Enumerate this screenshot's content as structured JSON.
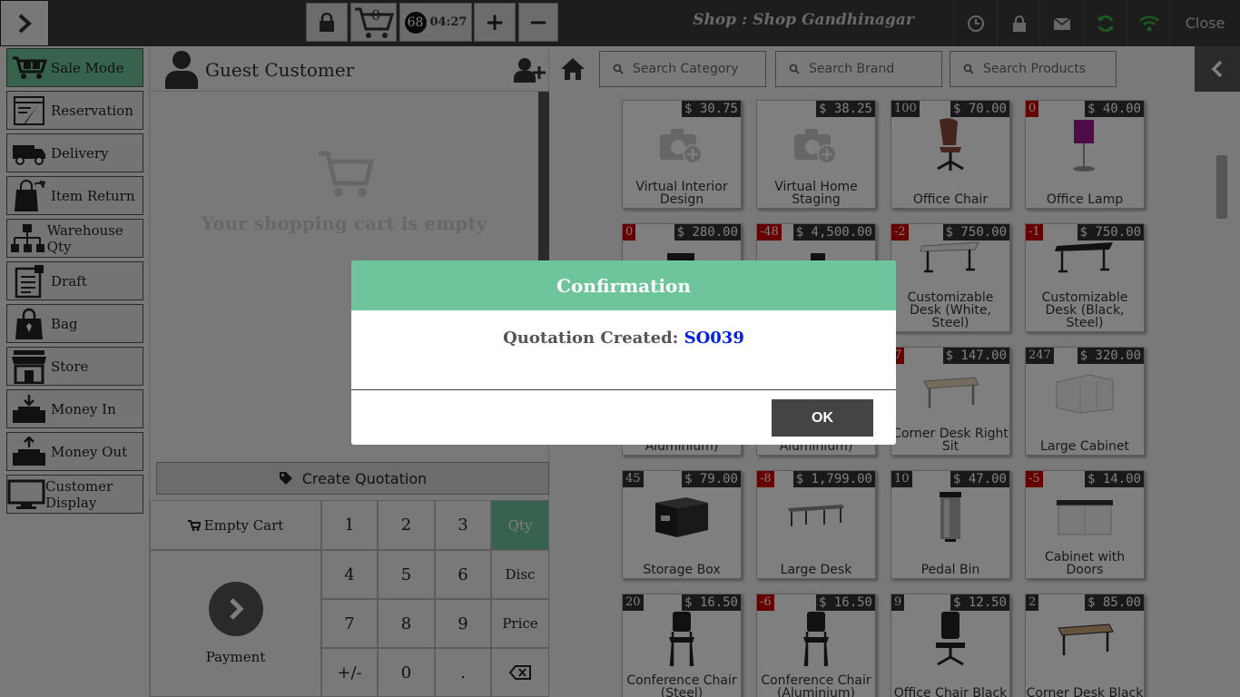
{
  "topbar": {
    "cart_count": "0",
    "timer_badge": "68",
    "timer_time": "04:27",
    "plus_label": "+",
    "minus_label": "−",
    "shop_title": "Shop : Shop Gandhinagar",
    "close_label": "Close",
    "colors": {
      "bar": "#3a3a3a",
      "wifi": "#3cb043",
      "sync": "#3cb043"
    }
  },
  "leftnav": {
    "items": [
      {
        "label": "Sale Mode",
        "icon": "cart-truck-icon",
        "active": true
      },
      {
        "label": "Reservation",
        "icon": "reservation-icon"
      },
      {
        "label": "Delivery",
        "icon": "delivery-truck-icon"
      },
      {
        "label": "Item Return",
        "icon": "return-bag-icon"
      },
      {
        "label": "Warehouse Qty",
        "icon": "warehouse-tree-icon"
      },
      {
        "label": "Draft",
        "icon": "draft-clipboard-icon"
      },
      {
        "label": "Bag",
        "icon": "bag-icon"
      },
      {
        "label": "Store",
        "icon": "store-icon"
      },
      {
        "label": "Money In",
        "icon": "money-in-icon"
      },
      {
        "label": "Money Out",
        "icon": "money-out-icon"
      },
      {
        "label": "Customer Display",
        "icon": "monitor-icon"
      }
    ]
  },
  "cart": {
    "customer_name": "Guest Customer",
    "empty_message": "Your shopping cart is empty",
    "create_quotation_label": "Create Quotation",
    "empty_cart_label": "Empty Cart",
    "payment_label": "Payment",
    "keys": {
      "k1": "1",
      "k2": "2",
      "k3": "3",
      "k4": "4",
      "k5": "5",
      "k6": "6",
      "k7": "7",
      "k8": "8",
      "k9": "9",
      "k0": "0",
      "sign": "+/-",
      "dot": ".",
      "qty": "Qty",
      "disc": "Disc",
      "price": "Price"
    }
  },
  "search": {
    "category_placeholder": "Search Category",
    "brand_placeholder": "Search Brand",
    "product_placeholder": "Search Products"
  },
  "products": [
    {
      "name": "Virtual Interior Design",
      "price": "$ 30.75",
      "qty": ""
    },
    {
      "name": "Virtual Home Staging",
      "price": "$ 38.25",
      "qty": ""
    },
    {
      "name": "Office Chair",
      "price": "$ 70.00",
      "qty": "100"
    },
    {
      "name": "Office Lamp",
      "price": "$ 40.00",
      "qty": "0"
    },
    {
      "name": "",
      "price": "$ 280.00",
      "qty": "0"
    },
    {
      "name": "",
      "price": "$ 4,500.00",
      "qty": "-48"
    },
    {
      "name": "Customizable Desk (White, Steel)",
      "price": "$ 750.00",
      "qty": "-2"
    },
    {
      "name": "Customizable Desk (Black, Steel)",
      "price": "$ 750.00",
      "qty": "-1"
    },
    {
      "name": "Aluminium)",
      "price": "",
      "qty": ""
    },
    {
      "name": "Aluminium)",
      "price": "",
      "qty": ""
    },
    {
      "name": "Corner Desk Right Sit",
      "price": "$ 147.00",
      "qty": "7"
    },
    {
      "name": "Large Cabinet",
      "price": "$ 320.00",
      "qty": "247"
    },
    {
      "name": "Storage Box",
      "price": "$ 79.00",
      "qty": "45"
    },
    {
      "name": "Large Desk",
      "price": "$ 1,799.00",
      "qty": "-8"
    },
    {
      "name": "Pedal Bin",
      "price": "$ 47.00",
      "qty": "10"
    },
    {
      "name": "Cabinet with Doors",
      "price": "$ 14.00",
      "qty": "-5"
    },
    {
      "name": "Conference Chair (Steel)",
      "price": "$ 16.50",
      "qty": "20"
    },
    {
      "name": "Conference Chair (Aluminium)",
      "price": "$ 16.50",
      "qty": "-6"
    },
    {
      "name": "Office Chair Black",
      "price": "$ 12.50",
      "qty": "9"
    },
    {
      "name": "Corner Desk Black",
      "price": "$ 85.00",
      "qty": "2"
    }
  ],
  "modal": {
    "title": "Confirmation",
    "message_prefix": "Quotation Created:",
    "reference": "SO039",
    "ok_label": "OK"
  }
}
